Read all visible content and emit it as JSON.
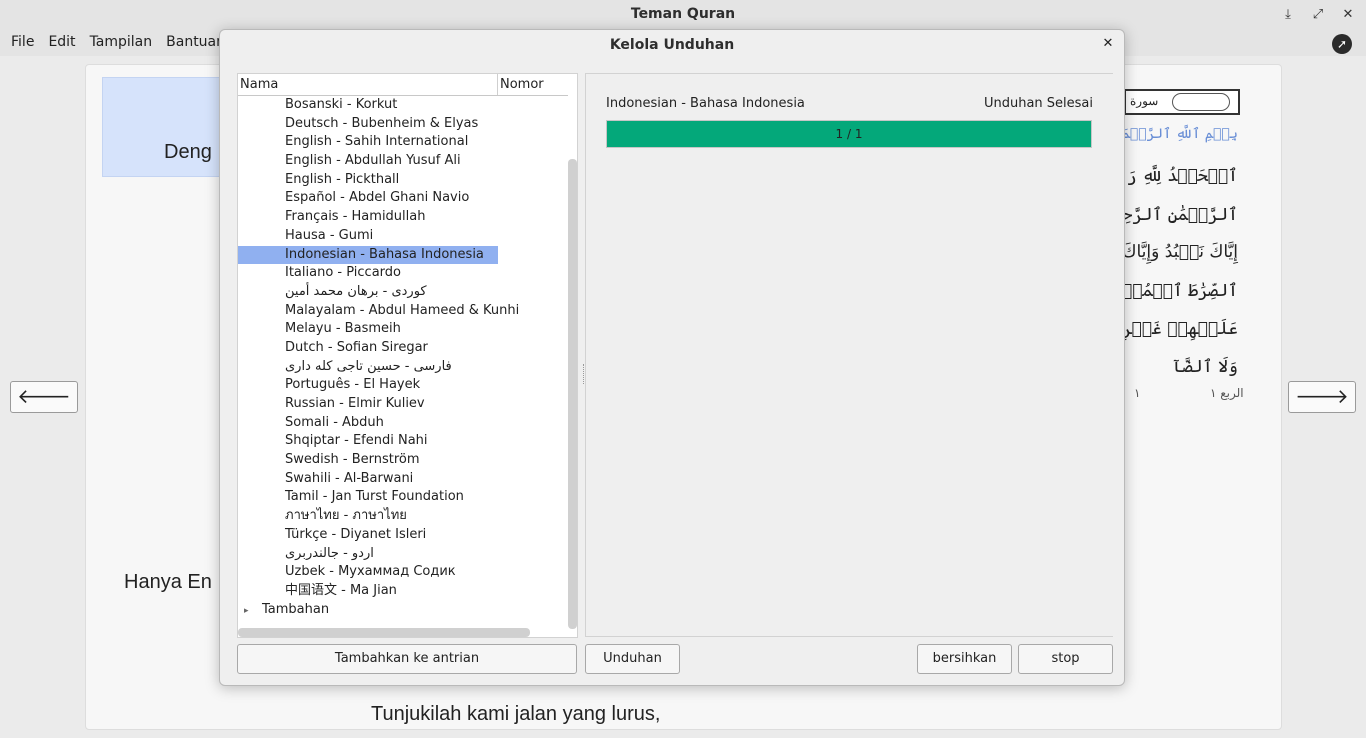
{
  "window": {
    "title": "Teman Quran"
  },
  "titlebar_icons": [
    "download-icon",
    "maximize-icon",
    "close-icon"
  ],
  "menu": [
    "File",
    "Edit",
    "Tampilan",
    "Bantuan"
  ],
  "reader": {
    "partial_texts": [
      "Deng",
      "Hanya En",
      "Tunjukilah kami jalan yang lurus,"
    ],
    "prev_glyph": "🡐",
    "next_glyph": "🡒",
    "page_number": "١",
    "rub_label": "الربع ١"
  },
  "dialog": {
    "title": "Kelola Unduhan",
    "close_glyph": "✕",
    "tree": {
      "col_name": "Nama",
      "col_number": "Nomor",
      "rows": [
        "Bosanski - Korkut",
        "Deutsch - Bubenheim & Elyas",
        "English - Sahih International",
        "English - Abdullah Yusuf Ali",
        "English - Pickthall",
        "Español - Abdel Ghani Navio",
        "Français - Hamidullah",
        "Hausa - Gumi",
        "Indonesian - Bahasa Indonesia",
        "Italiano - Piccardo",
        "كوردى - برهان محمد أمين",
        "Malayalam - Abdul Hameed & Kunhi",
        "Melayu - Basmeih",
        "Dutch - Sofian Siregar",
        "فارسى - حسين تاجى كله دارى",
        "Português - El Hayek",
        "Russian - Elmir Kuliev",
        "Somali - Abduh",
        "Shqiptar - Efendi Nahi",
        "Swedish - Bernström",
        "Swahili - Al-Barwani",
        "Tamil - Jan Turst Foundation",
        "ภาษาไทย - ภาษาไทย",
        "Türkçe - Diyanet Isleri",
        "اردو - جالندربرى",
        "Uzbek - Мухаммад Содик",
        "中国语文 - Ma Jian"
      ],
      "selected_index": 8,
      "group_label": "Tambahan"
    },
    "download": {
      "name": "Indonesian - Bahasa Indonesia",
      "status": "Unduhan Selesai",
      "progress_text": "1 / 1",
      "progress_fraction": 1.0,
      "progress_color": "#04a87a"
    },
    "buttons": {
      "add_queue": "Tambahkan ke antrian",
      "download": "Unduhan",
      "clear": "bersihkan",
      "stop": "stop"
    }
  }
}
